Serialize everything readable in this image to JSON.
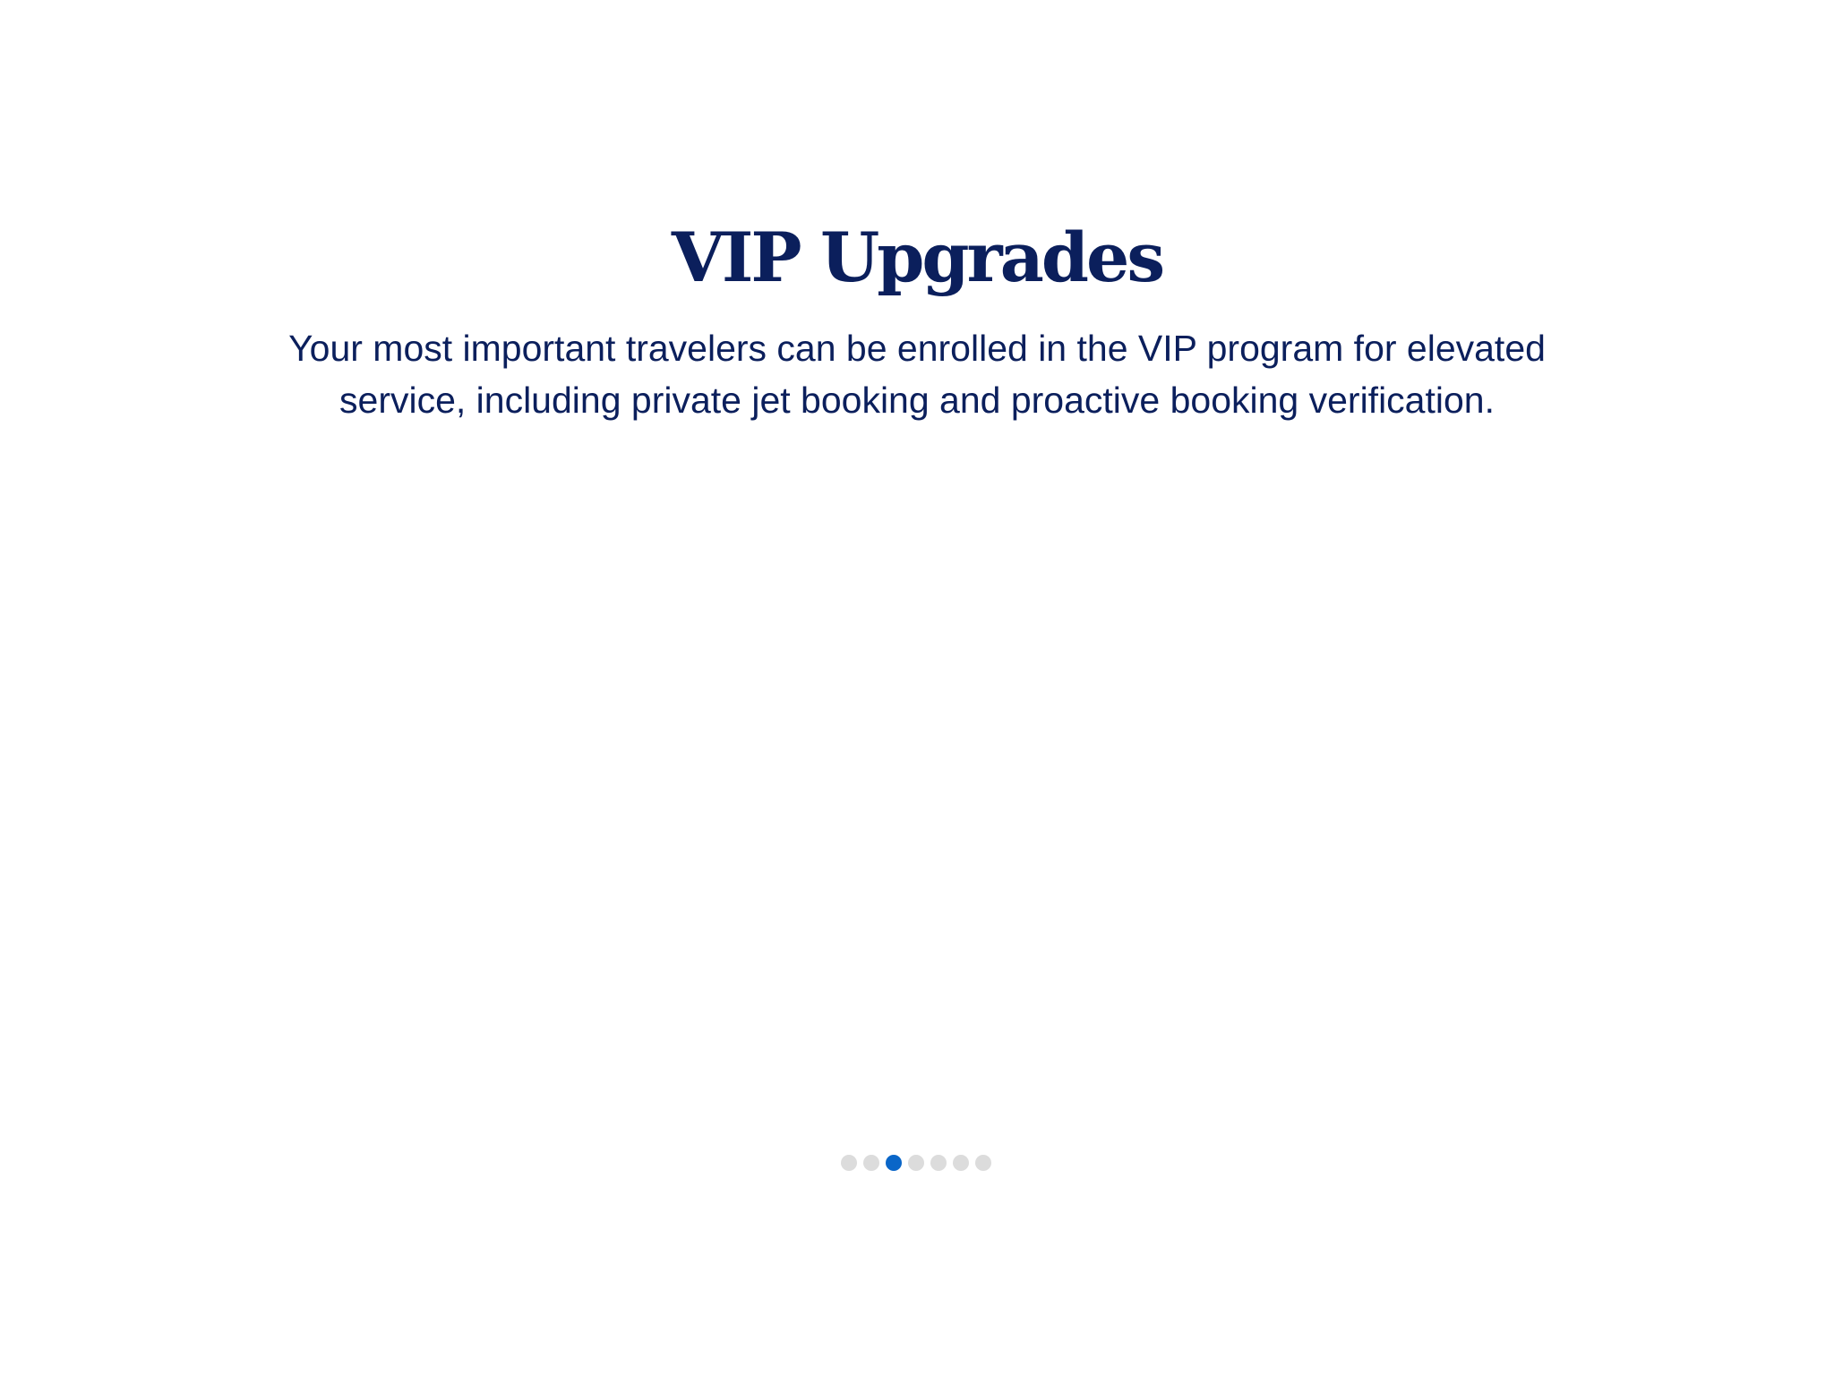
{
  "slide": {
    "title": "VIP Upgrades",
    "body": "Your most important travelers can be enrolled in the VIP program for elevated service, including private jet booking and proactive booking verification."
  },
  "pager": {
    "total": 7,
    "current": 3,
    "active_color": "#0a66c8",
    "inactive_color": "#dcdcdc"
  },
  "colors": {
    "text": "#0b1f5c",
    "background": "#ffffff"
  }
}
